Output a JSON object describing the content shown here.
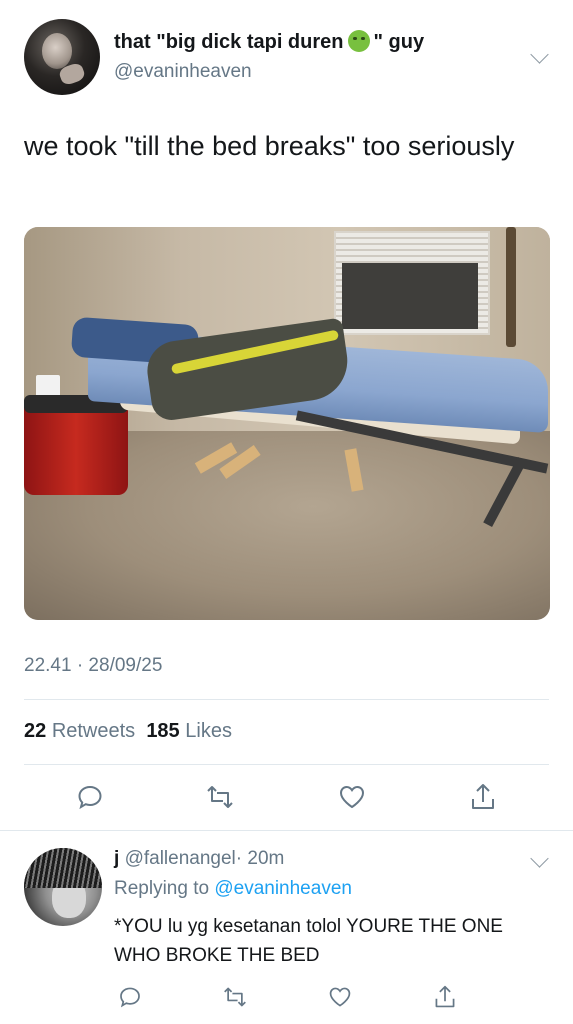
{
  "tweet": {
    "display_name": "that \"big dick tapi duren",
    "display_name_suffix": "\" guy",
    "name_emoji_icon": "nauseated-face-icon",
    "handle": "@evaninheaven",
    "text": "we took \"till the bed breaks\" too seriously",
    "timestamp": "22.41 · 28/09/25",
    "retweets_count": "22",
    "retweets_label": "Retweets",
    "likes_count": "185",
    "likes_label": "Likes"
  },
  "actions": [
    "reply-icon",
    "retweet-icon",
    "like-icon",
    "share-icon"
  ],
  "reply": {
    "display_name": "j",
    "handle": "@fallenangel",
    "time": "· 20m",
    "replying_prefix": "Replying to",
    "replying_to": "@evaninheaven",
    "text": "*YOU lu yg kesetanan tolol YOURE THE ONE WHO BROKE THE BED"
  },
  "colors": {
    "primary_text": "#14171a",
    "secondary_text": "#657786",
    "link": "#1da1f2",
    "divider": "#e1e8ed"
  }
}
